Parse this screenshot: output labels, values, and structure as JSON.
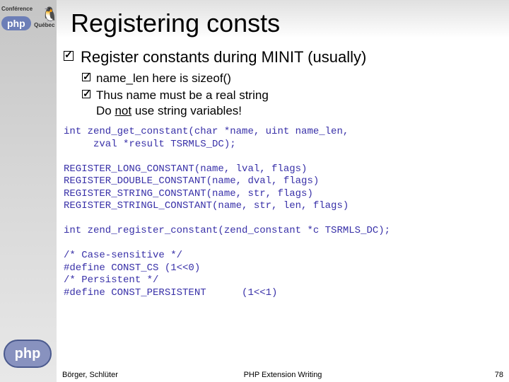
{
  "logo": {
    "conference": "Conférence",
    "php": "php",
    "region": "Québec",
    "bottomPhp": "php"
  },
  "title": "Registering consts",
  "mainBullet": "Register constants during MINIT (usually)",
  "subBullets": {
    "b1": "name_len here is sizeof()",
    "b2a": "Thus name must be a real string",
    "b2b_pre": "Do ",
    "b2b_not": "not",
    "b2b_post": " use string variables!"
  },
  "code": "int zend_get_constant(char *name, uint name_len,\n     zval *result TSRMLS_DC);\n\nREGISTER_LONG_CONSTANT(name, lval, flags)\nREGISTER_DOUBLE_CONSTANT(name, dval, flags)\nREGISTER_STRING_CONSTANT(name, str, flags)\nREGISTER_STRINGL_CONSTANT(name, str, len, flags)\n\nint zend_register_constant(zend_constant *c TSRMLS_DC);\n\n/* Case-sensitive */\n#define CONST_CS (1<<0)\n/* Persistent */\n#define CONST_PERSISTENT      (1<<1)",
  "footer": {
    "left": "Börger, Schlüter",
    "center": "PHP Extension Writing",
    "right": "78"
  }
}
